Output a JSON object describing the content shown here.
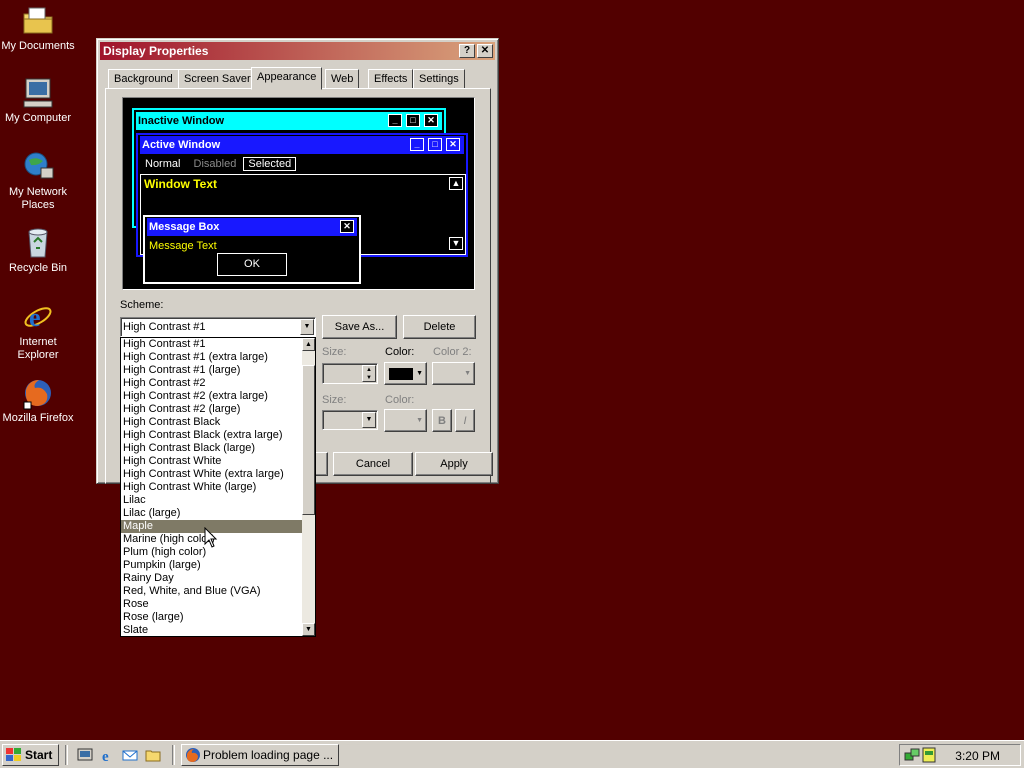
{
  "desktop": {
    "icons": [
      {
        "label": "My Documents",
        "icon": "folder-documents-icon"
      },
      {
        "label": "My Computer",
        "icon": "computer-icon"
      },
      {
        "label": "My Network Places",
        "icon": "network-icon"
      },
      {
        "label": "Recycle Bin",
        "icon": "recycle-bin-icon"
      },
      {
        "label": "Internet Explorer",
        "icon": "internet-explorer-icon"
      },
      {
        "label": "Mozilla Firefox",
        "icon": "firefox-icon"
      }
    ],
    "background_color": "#520000"
  },
  "window": {
    "title": "Display Properties",
    "help_button": "?",
    "close_button": "✕",
    "tabs": [
      {
        "label": "Background"
      },
      {
        "label": "Screen Saver"
      },
      {
        "label": "Appearance",
        "active": true
      },
      {
        "label": "Web"
      },
      {
        "label": "Effects"
      },
      {
        "label": "Settings"
      }
    ],
    "preview": {
      "inactive_title": "Inactive Window",
      "active_title": "Active Window",
      "menu_normal": "Normal",
      "menu_disabled": "Disabled",
      "menu_selected": "Selected",
      "window_text": "Window Text",
      "message_box_title": "Message Box",
      "message_text": "Message Text",
      "ok_label": "OK"
    },
    "scheme_label": "Scheme:",
    "scheme_value": "High Contrast #1",
    "save_as_label": "Save As...",
    "delete_label": "Delete",
    "size_label": "Size:",
    "color_label": "Color:",
    "color2_label": "Color 2:",
    "font_size_label": "Size:",
    "font_color_label": "Color:",
    "bold_label": "B",
    "italic_label": "I",
    "cancel_label": "Cancel",
    "apply_label": "Apply",
    "scheme_options": [
      "High Contrast #1",
      "High Contrast #1 (extra large)",
      "High Contrast #1 (large)",
      "High Contrast #2",
      "High Contrast #2 (extra large)",
      "High Contrast #2 (large)",
      "High Contrast Black",
      "High Contrast Black (extra large)",
      "High Contrast Black (large)",
      "High Contrast White",
      "High Contrast White (extra large)",
      "High Contrast White (large)",
      "Lilac",
      "Lilac (large)",
      "Maple",
      "Marine (high color)",
      "Plum (high color)",
      "Pumpkin (large)",
      "Rainy Day",
      "Red, White, and Blue (VGA)",
      "Rose",
      "Rose (large)",
      "Slate"
    ],
    "highlighted_option": "Maple"
  },
  "taskbar": {
    "start_label": "Start",
    "task_label": "Problem loading page ...",
    "clock": "3:20 PM"
  }
}
